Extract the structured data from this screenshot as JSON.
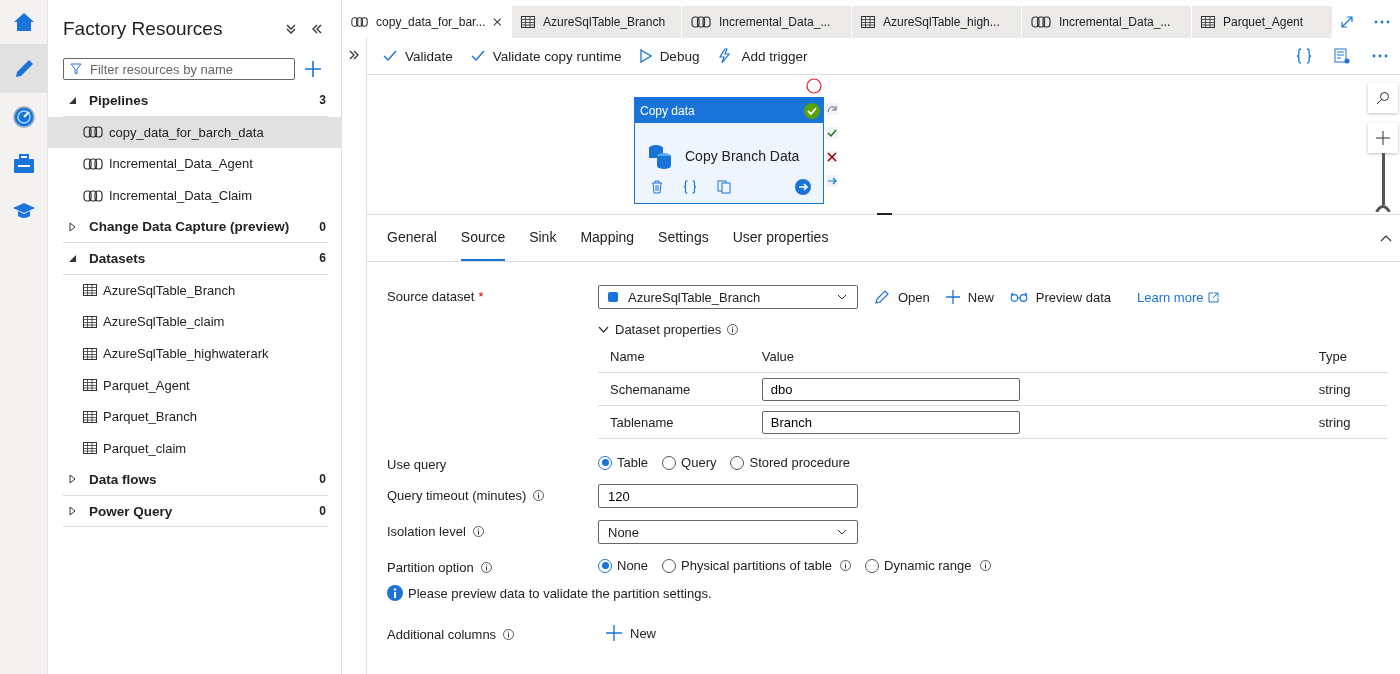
{
  "nav_rail": [
    {
      "kind": "home",
      "selected": false
    },
    {
      "kind": "author",
      "selected": true
    },
    {
      "kind": "monitor",
      "selected": false
    },
    {
      "kind": "manage",
      "selected": false
    },
    {
      "kind": "learn",
      "selected": false
    }
  ],
  "sidebar": {
    "title": "Factory Resources",
    "filter": {
      "placeholder": "Filter resources by name"
    },
    "sections": [
      {
        "label": "Pipelines",
        "count": "3",
        "expanded": true,
        "children": [
          {
            "label": "copy_data_for_barch_data",
            "kind": "pipeline",
            "selected": true
          },
          {
            "label": "Incremental_Data_Agent",
            "kind": "pipeline",
            "selected": false
          },
          {
            "label": "Incremental_Data_Claim",
            "kind": "pipeline",
            "selected": false
          }
        ]
      },
      {
        "label": "Change Data Capture (preview)",
        "count": "0",
        "expanded": false
      },
      {
        "label": "Datasets",
        "count": "6",
        "expanded": true,
        "children": [
          {
            "label": "AzureSqlTable_Branch",
            "kind": "table",
            "selected": false
          },
          {
            "label": "AzureSqlTable_claim",
            "kind": "table",
            "selected": false
          },
          {
            "label": "AzureSqlTable_highwaterark",
            "kind": "table",
            "selected": false
          },
          {
            "label": "Parquet_Agent",
            "kind": "table",
            "selected": false
          },
          {
            "label": "Parquet_Branch",
            "kind": "table",
            "selected": false
          },
          {
            "label": "Parquet_claim",
            "kind": "table",
            "selected": false
          }
        ]
      },
      {
        "label": "Data flows",
        "count": "0",
        "expanded": false
      },
      {
        "label": "Power Query",
        "count": "0",
        "expanded": false
      }
    ]
  },
  "tabs": [
    {
      "label": "copy_data_for_bar...",
      "kind": "pipeline",
      "selected": true
    },
    {
      "label": "AzureSqlTable_Branch",
      "kind": "table",
      "selected": false
    },
    {
      "label": "Incremental_Data_...",
      "kind": "pipeline",
      "selected": false
    },
    {
      "label": "AzureSqlTable_high...",
      "kind": "table",
      "selected": false
    },
    {
      "label": "Incremental_Data_...",
      "kind": "pipeline",
      "selected": false
    },
    {
      "label": "Parquet_Agent",
      "kind": "table",
      "selected": false
    }
  ],
  "toolbar": [
    {
      "kind": "validate",
      "label": "Validate"
    },
    {
      "kind": "validate",
      "label": "Validate copy runtime"
    },
    {
      "kind": "debug",
      "label": "Debug"
    },
    {
      "kind": "trigger",
      "label": "Add trigger"
    }
  ],
  "activity": {
    "type": "Copy data",
    "name": "Copy Branch Data"
  },
  "zoom_slider": {
    "level": 1
  },
  "panel_tabs": [
    {
      "label": "General",
      "selected": false
    },
    {
      "label": "Source",
      "selected": true
    },
    {
      "label": "Sink",
      "selected": false
    },
    {
      "label": "Mapping",
      "selected": false
    },
    {
      "label": "Settings",
      "selected": false
    },
    {
      "label": "User properties",
      "selected": false
    }
  ],
  "form": [
    {
      "kind": "dataset",
      "label": "Source dataset",
      "required_mark": "*",
      "value": "AzureSqlTable_Branch",
      "actions": [
        {
          "kind": "edit",
          "label": "Open"
        },
        {
          "kind": "add",
          "label": "New"
        },
        {
          "kind": "preview",
          "label": "Preview data"
        }
      ],
      "link": "Learn more",
      "properties": {
        "title": "Dataset properties",
        "expanded": true,
        "columns": [
          "Name",
          "Value",
          "Type"
        ],
        "rows": [
          {
            "name": "Schemaname",
            "value": "dbo",
            "type": "string"
          },
          {
            "name": "Tablename",
            "value": "Branch",
            "type": "string"
          }
        ]
      }
    },
    {
      "kind": "radio",
      "label": "Use query",
      "options": [
        {
          "label": "Table",
          "selected": true
        },
        {
          "label": "Query",
          "selected": false
        },
        {
          "label": "Stored procedure",
          "selected": false
        }
      ]
    },
    {
      "kind": "text",
      "label": "Query timeout (minutes)",
      "info": true,
      "value": "120"
    },
    {
      "kind": "select",
      "label": "Isolation level",
      "info": true,
      "value": "None"
    },
    {
      "kind": "radio",
      "label": "Partition option",
      "info": true,
      "options": [
        {
          "label": "None",
          "selected": true
        },
        {
          "label": "Physical partitions of table",
          "selected": false,
          "info": true
        },
        {
          "label": "Dynamic range",
          "selected": false,
          "info": true
        }
      ]
    },
    {
      "kind": "note",
      "text": "Please preview data to validate the partition settings."
    },
    {
      "kind": "add",
      "label": "Additional columns",
      "info": true,
      "button": "New"
    }
  ]
}
